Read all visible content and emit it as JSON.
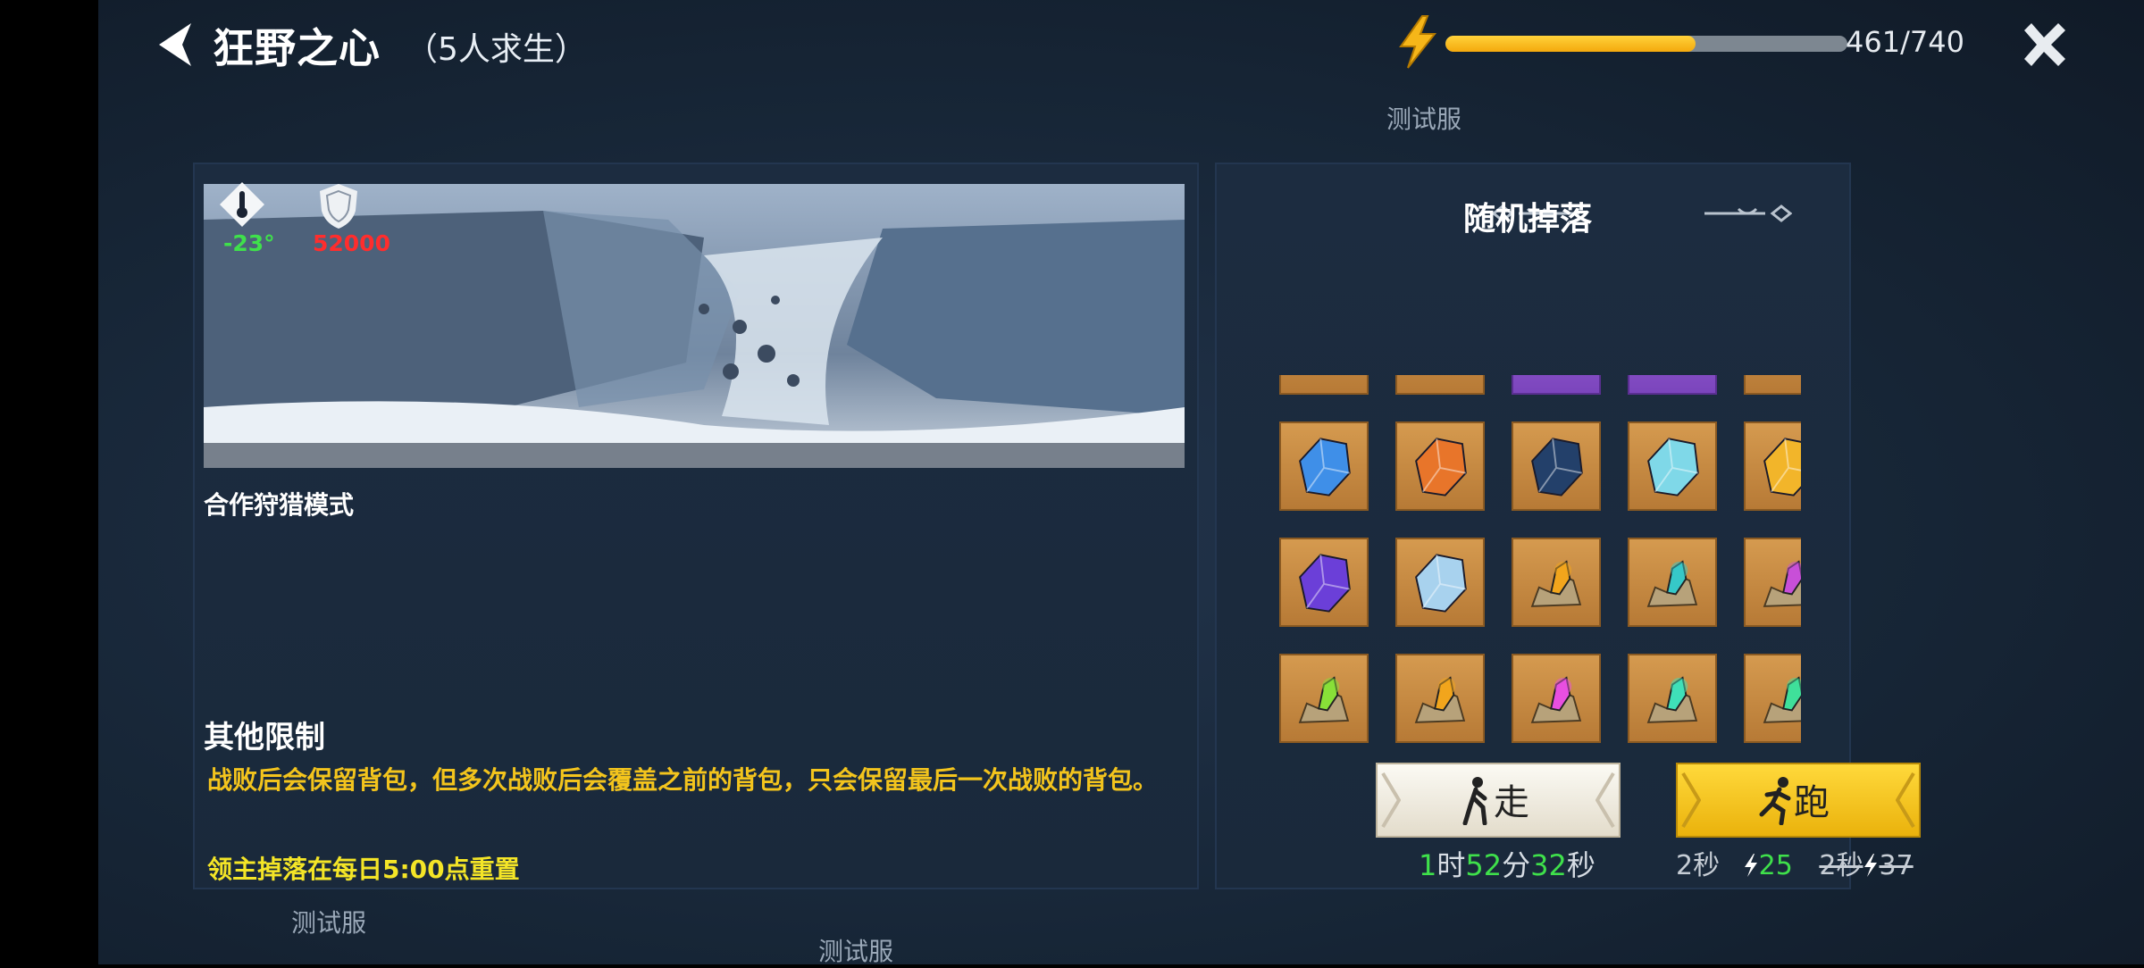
{
  "header": {
    "title": "狂野之心",
    "subtitle": "（5人求生）",
    "energy_text": "461/740",
    "energy_fraction": 0.623
  },
  "watermark": "测试服",
  "stats": {
    "temperature": "-23°",
    "defense": "52000"
  },
  "mode_label": "合作狩猎模式",
  "restrictions": {
    "title": "其他限制",
    "text": "战败后会保留背包，但多次战败后会覆盖之前的背包，只会保留最后一次战败的背包。",
    "reset_note": "领主掉落在每日5:00点重置"
  },
  "drops": {
    "title": "随机掉落",
    "row0": [
      "orange",
      "orange",
      "purple",
      "purple",
      "orange"
    ],
    "items": [
      {
        "type": "crystal",
        "color": "#3f8fe8"
      },
      {
        "type": "crystal",
        "color": "#e8752a"
      },
      {
        "type": "crystal",
        "color": "#23406a"
      },
      {
        "type": "crystal",
        "color": "#7fd8e8"
      },
      {
        "type": "crystal",
        "color": "#f2b52a"
      },
      {
        "type": "crystal",
        "color": "#6b3fd8"
      },
      {
        "type": "crystal",
        "color": "#a8d2ee"
      },
      {
        "type": "ore",
        "color": "#f2a51c"
      },
      {
        "type": "ore",
        "color": "#36c8c8"
      },
      {
        "type": "ore",
        "color": "#c84fd8"
      },
      {
        "type": "ore",
        "color": "#88e038"
      },
      {
        "type": "ore",
        "color": "#f2a51c"
      },
      {
        "type": "ore",
        "color": "#e84fe0"
      },
      {
        "type": "ore",
        "color": "#3fe0b8"
      },
      {
        "type": "ore",
        "color": "#3fe09a"
      }
    ]
  },
  "walk": {
    "label": "走",
    "h": "1",
    "h_unit": "时",
    "m": "52",
    "m_unit": "分",
    "s": "32",
    "s_unit": "秒"
  },
  "run": {
    "label": "跑",
    "time": "2秒",
    "cost": "25",
    "old_time": "2秒",
    "old_cost": "37"
  }
}
